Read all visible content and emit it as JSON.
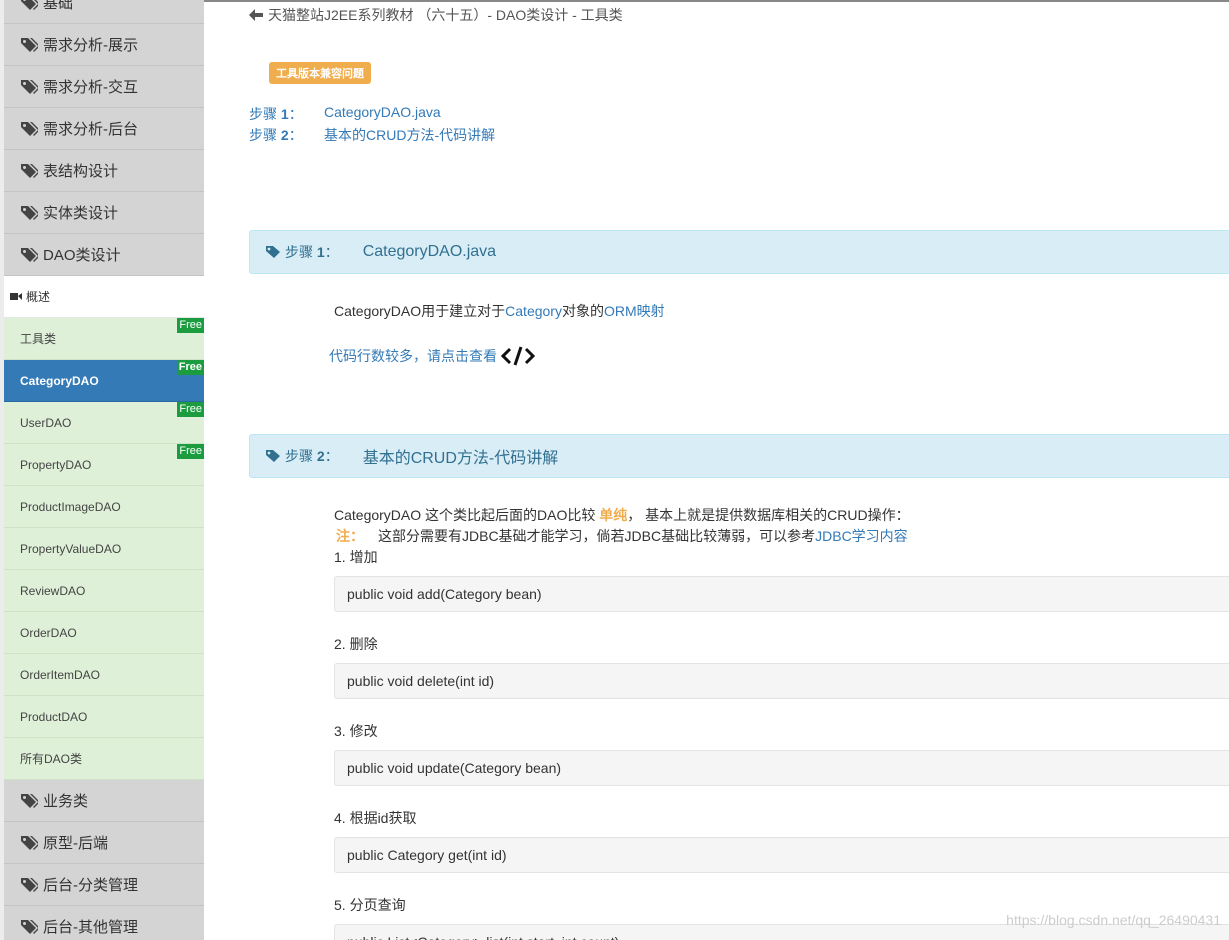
{
  "sidebar": {
    "categories_top": [
      {
        "label": "基础"
      },
      {
        "label": "需求分析-展示"
      },
      {
        "label": "需求分析-交互"
      },
      {
        "label": "需求分析-后台"
      },
      {
        "label": "表结构设计"
      },
      {
        "label": "实体类设计"
      },
      {
        "label": "DAO类设计"
      }
    ],
    "section_label": "概述",
    "items": [
      {
        "label": "工具类",
        "free": "Free"
      },
      {
        "label": "CategoryDAO",
        "free": "Free"
      },
      {
        "label": "UserDAO",
        "free": "Free"
      },
      {
        "label": "PropertyDAO",
        "free": "Free"
      },
      {
        "label": "ProductImageDAO"
      },
      {
        "label": "PropertyValueDAO"
      },
      {
        "label": "ReviewDAO"
      },
      {
        "label": "OrderDAO"
      },
      {
        "label": "OrderItemDAO"
      },
      {
        "label": "ProductDAO"
      },
      {
        "label": "所有DAO类"
      }
    ],
    "categories_bottom": [
      {
        "label": "业务类"
      },
      {
        "label": "原型-后端"
      },
      {
        "label": "后台-分类管理"
      },
      {
        "label": "后台-其他管理"
      }
    ]
  },
  "main": {
    "breadcrumb": "天猫整站J2EE系列教材 （六十五）- DAO类设计 - 工具类",
    "badge": "工具版本兼容问题",
    "toc": [
      {
        "step": "步骤",
        "num": "1",
        "sep": "：",
        "title": "CategoryDAO.java"
      },
      {
        "step": "步骤",
        "num": "2",
        "sep": "：",
        "title": "基本的CRUD方法-代码讲解"
      }
    ],
    "step1": {
      "label": "步骤",
      "num": "1",
      "sep": "：",
      "title": "CategoryDAO.java",
      "text_a": "CategoryDAO用于建立对于",
      "text_link1": "Category",
      "text_b": "对象的",
      "text_link2": "ORM映射",
      "code_link": "代码行数较多，请点击查看"
    },
    "step2": {
      "label": "步骤",
      "num": "2",
      "sep": "：",
      "title": "基本的CRUD方法-代码讲解",
      "intro_a": "CategoryDAO 这个类比起后面的DAO比较 ",
      "intro_emph": "单纯",
      "intro_b": "， 基本上就是提供数据库相关的CRUD操作：",
      "note_label": "注：",
      "note_text": "这部分需要有JDBC基础才能学习，倘若JDBC基础比较薄弱，可以参考",
      "note_link": "JDBC学习内容",
      "ops": [
        {
          "label": "1. 增加",
          "code": "public void add(Category bean)"
        },
        {
          "label": "2. 删除",
          "code": "public void delete(int id)"
        },
        {
          "label": "3. 修改",
          "code": "public void update(Category bean)"
        },
        {
          "label": "4. 根据id获取",
          "code": "public Category get(int id)"
        },
        {
          "label": "5. 分页查询",
          "code": "public List<Category> list(int start, int count)"
        }
      ]
    },
    "watermark": "https://blog.csdn.net/qq_26490431"
  }
}
